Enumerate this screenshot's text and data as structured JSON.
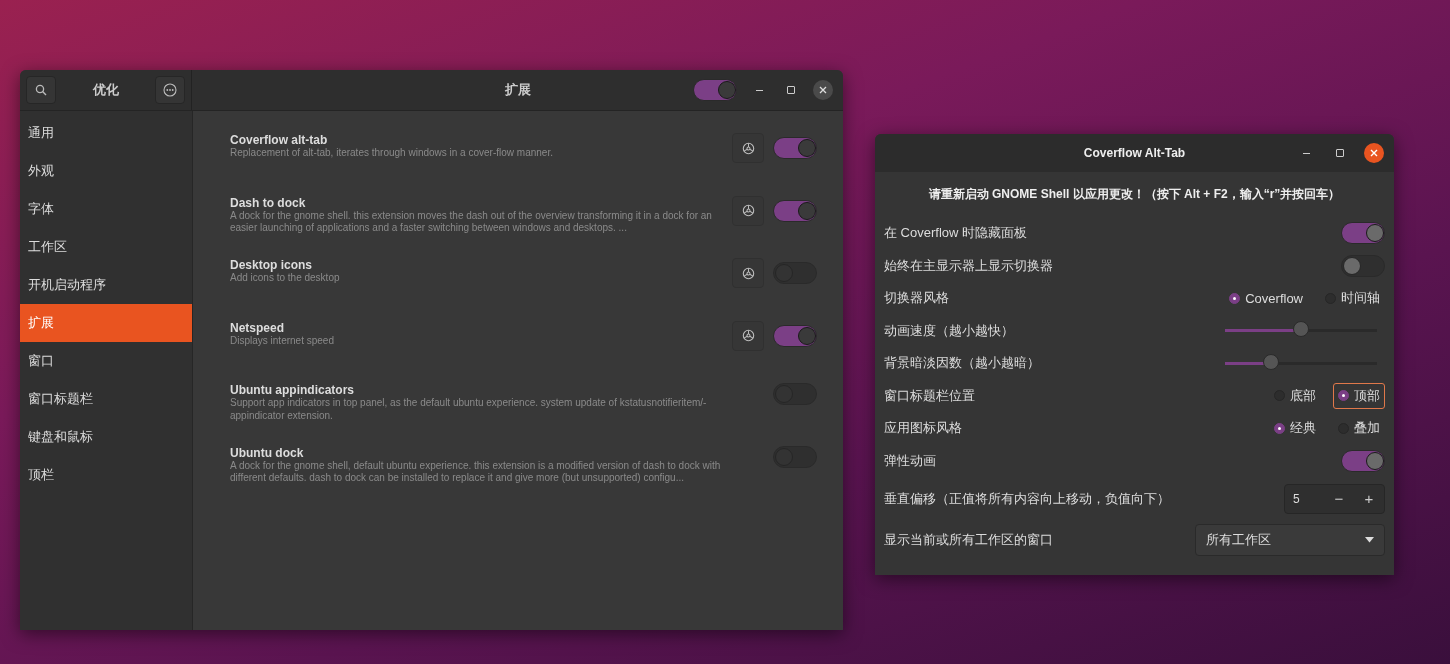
{
  "tweaks_window": {
    "app_title": "优化",
    "page_title": "扩展",
    "global_toggle_on": true,
    "sidebar": {
      "items": [
        {
          "label": "通用",
          "selected": false
        },
        {
          "label": "外观",
          "selected": false
        },
        {
          "label": "字体",
          "selected": false
        },
        {
          "label": "工作区",
          "selected": false
        },
        {
          "label": "开机启动程序",
          "selected": false
        },
        {
          "label": "扩展",
          "selected": true
        },
        {
          "label": "窗口",
          "selected": false
        },
        {
          "label": "窗口标题栏",
          "selected": false
        },
        {
          "label": "键盘和鼠标",
          "selected": false
        },
        {
          "label": "顶栏",
          "selected": false
        }
      ]
    },
    "extensions": [
      {
        "name": "Coverflow alt-tab",
        "description": "Replacement of alt-tab, iterates through windows in a cover-flow manner.",
        "settings_button": true,
        "on": true
      },
      {
        "name": "Dash to dock",
        "description": "A dock for the gnome shell. this extension moves the dash out of the overview transforming it in a dock for an easier launching of applications and a faster switching between windows and desktops. ...",
        "settings_button": true,
        "on": true
      },
      {
        "name": "Desktop icons",
        "description": "Add icons to the desktop",
        "settings_button": true,
        "on": false
      },
      {
        "name": "Netspeed",
        "description": "Displays internet speed",
        "settings_button": true,
        "on": true
      },
      {
        "name": "Ubuntu appindicators",
        "description": "Support app indicators in top panel, as the default ubuntu experience. system update of kstatusnotifieritem/-appindicator extension.",
        "settings_button": false,
        "on": false
      },
      {
        "name": "Ubuntu dock",
        "description": "A dock for the gnome shell, default ubuntu experience. this extension is a modified version of dash to dock with different defaults. dash to dock can be installed to replace it and give more (but unsupported) configu...",
        "settings_button": false,
        "on": false
      }
    ]
  },
  "dialog": {
    "title": "Coverflow Alt-Tab",
    "notice": "请重新启动 GNOME Shell 以应用更改！（按下 Alt + F2，输入“r”并按回车）",
    "settings": [
      {
        "kind": "toggle",
        "label": "在 Coverflow 时隐藏面板",
        "on": true
      },
      {
        "kind": "toggle",
        "label": "始终在主显示器上显示切换器",
        "on": false
      },
      {
        "kind": "radio",
        "label": "切换器风格",
        "options": [
          {
            "label": "Coverflow",
            "selected": true,
            "focused": false
          },
          {
            "label": "时间轴",
            "selected": false,
            "focused": false
          }
        ]
      },
      {
        "kind": "slider",
        "label": "动画速度（越小越快）",
        "level": 0.5
      },
      {
        "kind": "slider",
        "label": "背景暗淡因数（越小越暗）",
        "level": 0.3
      },
      {
        "kind": "radio",
        "label": "窗口标题栏位置",
        "options": [
          {
            "label": "底部",
            "selected": false,
            "focused": false
          },
          {
            "label": "顶部",
            "selected": true,
            "focused": true
          }
        ]
      },
      {
        "kind": "radio",
        "label": "应用图标风格",
        "options": [
          {
            "label": "经典",
            "selected": true,
            "focused": false
          },
          {
            "label": "叠加",
            "selected": false,
            "focused": false
          }
        ]
      },
      {
        "kind": "toggle",
        "label": "弹性动画",
        "on": true
      },
      {
        "kind": "spin",
        "label": "垂直偏移（正值将所有内容向上移动，负值向下）",
        "value": "5",
        "minus": "−",
        "plus": "+"
      },
      {
        "kind": "dropdown",
        "label": "显示当前或所有工作区的窗口",
        "value": "所有工作区"
      }
    ]
  }
}
